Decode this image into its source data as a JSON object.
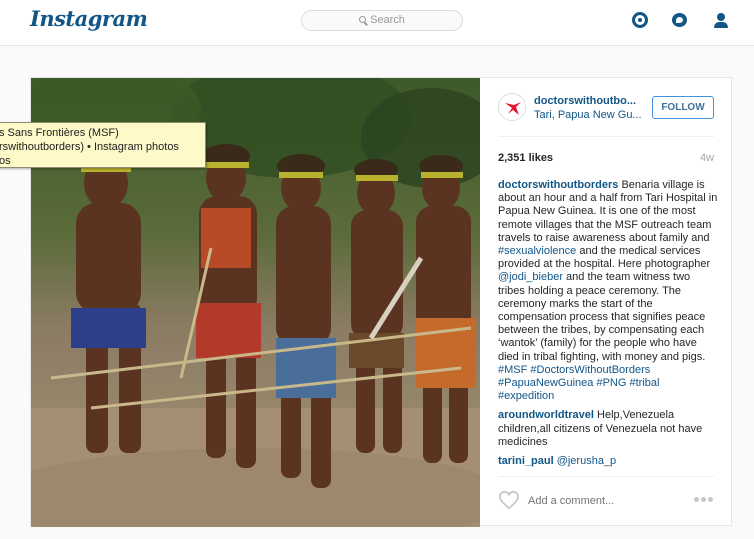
{
  "nav": {
    "logo": "Instagram",
    "search_placeholder": "Search",
    "icons": [
      "compass-icon",
      "activity-icon",
      "profile-icon"
    ],
    "accent": "#125688"
  },
  "post": {
    "username": "doctorswithoutbo...",
    "location": "Tari, Papua New Gu...",
    "follow_label": "FOLLOW",
    "likes": "2,351 likes",
    "time_ago": "4w",
    "comments": [
      {
        "user": "doctorswithoutborders",
        "parts": [
          {
            "t": " Benaria village is about an hour and a half from Tari Hospital in Papua New Guinea. It is one of the most remote villages that the MSF outreach team travels to raise awareness about family and "
          },
          {
            "t": "#sexualviolence",
            "tag": true
          },
          {
            "t": " and the medical services provided at the hospital. Here photographer "
          },
          {
            "t": "@jodi_bieber",
            "tag": true
          },
          {
            "t": " and the team witness two tribes holding a peace ceremony. The ceremony marks the start of the compensation process that signifies peace between the tribes, by compensating each ‘wantok’ (family) for the people who have died in tribal fighting, with money and pigs. "
          },
          {
            "t": "#MSF",
            "tag": true
          },
          {
            "t": " "
          },
          {
            "t": "#DoctorsWithoutBorders",
            "tag": true
          },
          {
            "t": " "
          },
          {
            "t": "#PapuaNewGuinea",
            "tag": true
          },
          {
            "t": " "
          },
          {
            "t": "#PNG",
            "tag": true
          },
          {
            "t": " "
          },
          {
            "t": "#tribal",
            "tag": true
          },
          {
            "t": " "
          },
          {
            "t": "#expedition",
            "tag": true
          }
        ]
      },
      {
        "user": "aroundworldtravel",
        "parts": [
          {
            "t": " Help,Venezuela children,all citizens of Venezuela not have medicines"
          }
        ]
      },
      {
        "user": "tarini_paul",
        "parts": [
          {
            "t": " "
          },
          {
            "t": "@jerusha_p",
            "tag": true
          }
        ]
      }
    ],
    "add_comment_placeholder": "Add a comment..."
  },
  "tooltip": {
    "line1": "s Sans Frontières (MSF)",
    "line2": "rswithoutborders) • Instagram photos",
    "line3": "os"
  }
}
